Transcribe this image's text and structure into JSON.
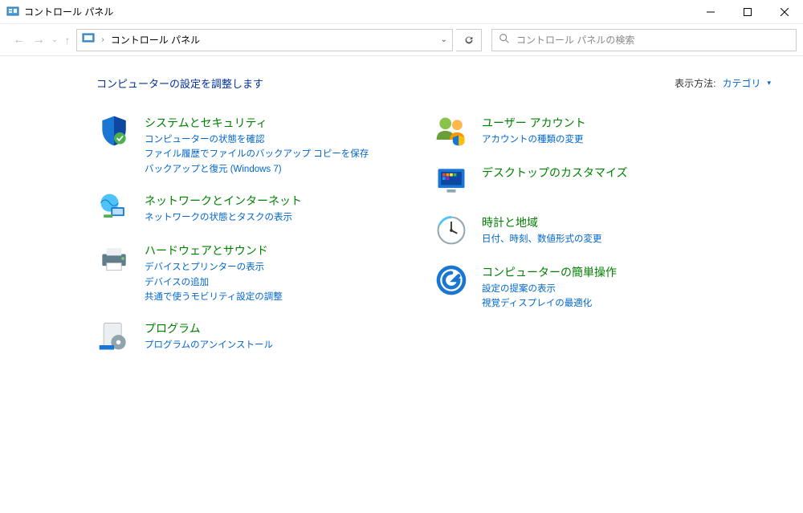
{
  "window": {
    "title": "コントロール パネル"
  },
  "breadcrumb": {
    "path": "コントロール パネル"
  },
  "search": {
    "placeholder": "コントロール パネルの検索"
  },
  "main": {
    "heading": "コンピューターの設定を調整します",
    "view_label": "表示方法:",
    "view_value": "カテゴリ"
  },
  "categories_left": [
    {
      "title": "システムとセキュリティ",
      "links": [
        "コンピューターの状態を確認",
        "ファイル履歴でファイルのバックアップ コピーを保存",
        "バックアップと復元 (Windows 7)"
      ]
    },
    {
      "title": "ネットワークとインターネット",
      "links": [
        "ネットワークの状態とタスクの表示"
      ]
    },
    {
      "title": "ハードウェアとサウンド",
      "links": [
        "デバイスとプリンターの表示",
        "デバイスの追加",
        "共通で使うモビリティ設定の調整"
      ]
    },
    {
      "title": "プログラム",
      "links": [
        "プログラムのアンインストール"
      ]
    }
  ],
  "categories_right": [
    {
      "title": "ユーザー アカウント",
      "links": [
        "アカウントの種類の変更"
      ]
    },
    {
      "title": "デスクトップのカスタマイズ",
      "links": []
    },
    {
      "title": "時計と地域",
      "links": [
        "日付、時刻、数値形式の変更"
      ]
    },
    {
      "title": "コンピューターの簡単操作",
      "links": [
        "設定の提案の表示",
        "視覚ディスプレイの最適化"
      ]
    }
  ]
}
